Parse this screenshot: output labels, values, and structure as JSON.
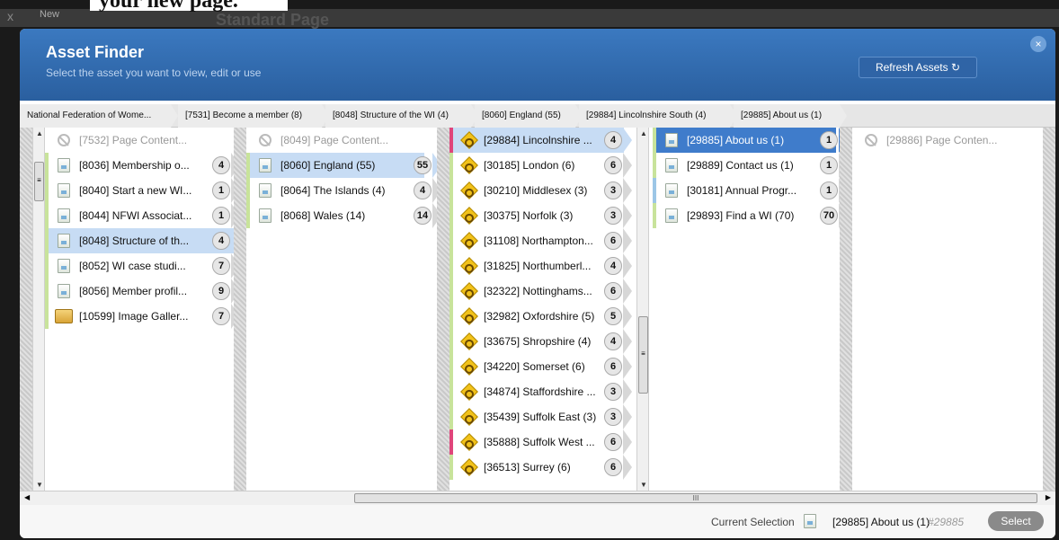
{
  "background": {
    "close_glyph": "x",
    "new_label": "New",
    "cutoff_heading": "your new page.",
    "standard_page": "Standard Page"
  },
  "header": {
    "title": "Asset Finder",
    "subtitle": "Select the asset you want to view, edit or use",
    "refresh_label": "Refresh Assets",
    "refresh_glyph": "↻",
    "close_glyph": "×"
  },
  "breadcrumb": [
    "National Federation of Wome...",
    "[7531] Become a member (8)",
    "[8048] Structure of the WI (4)",
    "[8060] England (55)",
    "[29884] Lincolnshire South (4)",
    "[29885] About us (1)"
  ],
  "columns": [
    {
      "rows": [
        {
          "label": "[7532] Page Content...",
          "count": "",
          "icon": "no-entry-icon",
          "state": "dim"
        },
        {
          "label": "[8036] Membership o...",
          "count": "4",
          "icon": "page-icon",
          "state": ""
        },
        {
          "label": "[8040] Start a new WI...",
          "count": "1",
          "icon": "page-icon",
          "state": ""
        },
        {
          "label": "[8044] NFWI Associat...",
          "count": "1",
          "icon": "page-icon",
          "state": ""
        },
        {
          "label": "[8048] Structure of th...",
          "count": "4",
          "icon": "page-icon",
          "state": "sel"
        },
        {
          "label": "[8052] WI case studi...",
          "count": "7",
          "icon": "page-icon",
          "state": ""
        },
        {
          "label": "[8056] Member profil...",
          "count": "9",
          "icon": "page-icon",
          "state": ""
        },
        {
          "label": "[10599] Image Galler...",
          "count": "7",
          "icon": "folder-icon",
          "state": ""
        }
      ]
    },
    {
      "rows": [
        {
          "label": "[8049] Page Content...",
          "count": "",
          "icon": "no-entry-icon",
          "state": "dim"
        },
        {
          "label": "[8060] England (55)",
          "count": "55",
          "icon": "page-icon",
          "state": "sel"
        },
        {
          "label": "[8064] The Islands (4)",
          "count": "4",
          "icon": "page-icon",
          "state": ""
        },
        {
          "label": "[8068] Wales (14)",
          "count": "14",
          "icon": "page-icon",
          "state": ""
        }
      ]
    },
    {
      "rows": [
        {
          "label": "[29884] Lincolnshire ...",
          "count": "4",
          "icon": "site-icon",
          "state": "sel",
          "mark": "#e0457b"
        },
        {
          "label": "[30185] London (6)",
          "count": "6",
          "icon": "site-icon",
          "state": ""
        },
        {
          "label": "[30210] Middlesex (3)",
          "count": "3",
          "icon": "site-icon",
          "state": ""
        },
        {
          "label": "[30375] Norfolk (3)",
          "count": "3",
          "icon": "site-icon",
          "state": ""
        },
        {
          "label": "[31108] Northampton...",
          "count": "6",
          "icon": "site-icon",
          "state": ""
        },
        {
          "label": "[31825] Northumberl...",
          "count": "4",
          "icon": "site-icon",
          "state": ""
        },
        {
          "label": "[32322] Nottinghams...",
          "count": "6",
          "icon": "site-icon",
          "state": ""
        },
        {
          "label": "[32982] Oxfordshire (5)",
          "count": "5",
          "icon": "site-icon",
          "state": ""
        },
        {
          "label": "[33675] Shropshire (4)",
          "count": "4",
          "icon": "site-icon",
          "state": ""
        },
        {
          "label": "[34220] Somerset (6)",
          "count": "6",
          "icon": "site-icon",
          "state": ""
        },
        {
          "label": "[34874] Staffordshire ...",
          "count": "3",
          "icon": "site-icon",
          "state": ""
        },
        {
          "label": "[35439] Suffolk East (3)",
          "count": "3",
          "icon": "site-icon",
          "state": ""
        },
        {
          "label": "[35888] Suffolk West ...",
          "count": "6",
          "icon": "site-icon",
          "state": "",
          "mark": "#e0457b"
        },
        {
          "label": "[36513] Surrey (6)",
          "count": "6",
          "icon": "site-icon",
          "state": ""
        }
      ]
    },
    {
      "rows": [
        {
          "label": "[29885] About us (1)",
          "count": "1",
          "icon": "page-icon",
          "state": "active"
        },
        {
          "label": "[29889] Contact us (1)",
          "count": "1",
          "icon": "page-icon",
          "state": ""
        },
        {
          "label": "[30181] Annual Progr...",
          "count": "1",
          "icon": "page-icon",
          "state": "",
          "mark": "#9cc6e6"
        },
        {
          "label": "[29893] Find a WI (70)",
          "count": "70",
          "icon": "page-icon",
          "state": ""
        }
      ]
    },
    {
      "rows": [
        {
          "label": "[29886] Page Conten...",
          "count": "",
          "icon": "no-entry-icon",
          "state": "dim"
        }
      ]
    }
  ],
  "scrollbar": {
    "thumb_grip": "III",
    "up_glyph": "▲",
    "down_glyph": "▼",
    "left_glyph": "◀",
    "right_glyph": "▶",
    "grip_glyph": "≡"
  },
  "footer": {
    "current_selection_label": "Current Selection",
    "selected_name": "[29885] About us (1)",
    "selected_id": "#29885",
    "select_label": "Select"
  },
  "colors": {
    "header": "#2f6cb3",
    "selected_row": "#c7dcf4",
    "active_row": "#3f7ccb",
    "new_mark": "#c8e39b",
    "pink_mark": "#e0457b"
  }
}
